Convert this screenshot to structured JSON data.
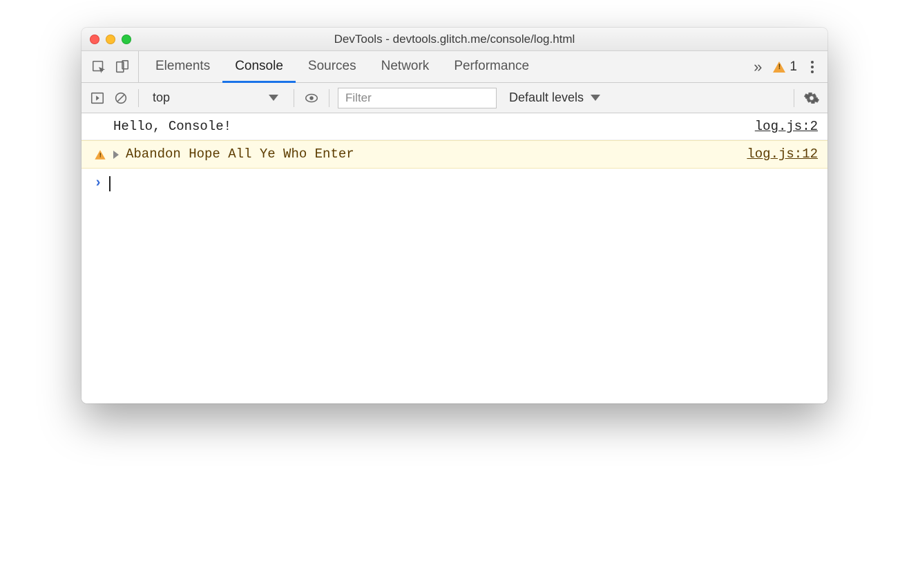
{
  "window": {
    "title": "DevTools - devtools.glitch.me/console/log.html"
  },
  "tabs": {
    "items": [
      "Elements",
      "Console",
      "Sources",
      "Network",
      "Performance"
    ],
    "active_index": 1,
    "overflow_glyph": "»"
  },
  "warning_badge": {
    "count": "1"
  },
  "toolbar": {
    "context": "top",
    "filter_placeholder": "Filter",
    "levels_label": "Default levels"
  },
  "messages": [
    {
      "type": "info",
      "text": "Hello, Console!",
      "source": "log.js:2"
    },
    {
      "type": "warn",
      "text": "Abandon Hope All Ye Who Enter",
      "source": "log.js:12"
    }
  ],
  "prompt": {
    "glyph": "›"
  }
}
